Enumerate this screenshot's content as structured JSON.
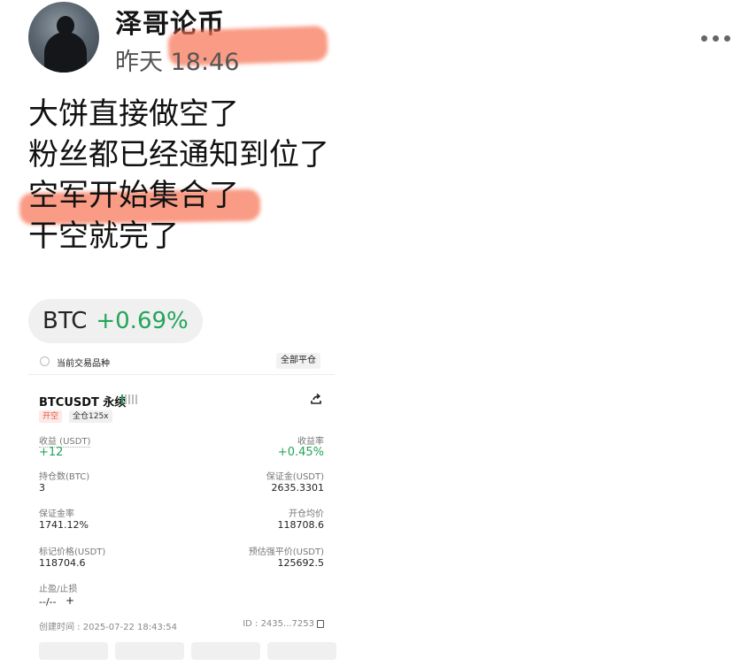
{
  "post": {
    "author": "泽哥论币",
    "time": "昨天 18:46",
    "lines": [
      "大饼直接做空了",
      "粉丝都已经通知到位了",
      "空军开始集合了",
      "干空就完了"
    ]
  },
  "ticker": {
    "symbol": "BTC",
    "change": "+0.69%",
    "change_color": "#22a559"
  },
  "position_card": {
    "current_label": "当前交易品种",
    "close_all": "全部平仓",
    "pair": "BTCUSDT 永续",
    "side_tag": "开空",
    "margin_tag": "全仓125x",
    "pnl_label": "收益 (USDT)",
    "pnl_value": "+12",
    "roe_label": "收益率",
    "roe_value": "+0.45%",
    "size_label": "持仓数(BTC)",
    "size_value": "3",
    "margin_label": "保证金(USDT)",
    "margin_value": "2635.3301",
    "margin_ratio_label": "保证金率",
    "margin_ratio_value": "1741.12%",
    "entry_label": "开仓均价",
    "entry_value": "118708.6",
    "mark_label": "标记价格(USDT)",
    "mark_value": "118704.6",
    "liq_label": "预估强平价(USDT)",
    "liq_value": "125692.5",
    "tpsl_label": "止盈/止损",
    "tpsl_value": "--/--",
    "tpsl_add": "+",
    "created": "创建时间 : 2025-07-22 18:43:54",
    "id": "ID : 2435...7253"
  },
  "colors": {
    "highlight": "#f67456",
    "profit": "#22a559",
    "short": "#e2533e"
  },
  "icons": [
    "more-icon",
    "share-icon",
    "copy-icon",
    "radio-icon",
    "signal-bars-icon"
  ]
}
